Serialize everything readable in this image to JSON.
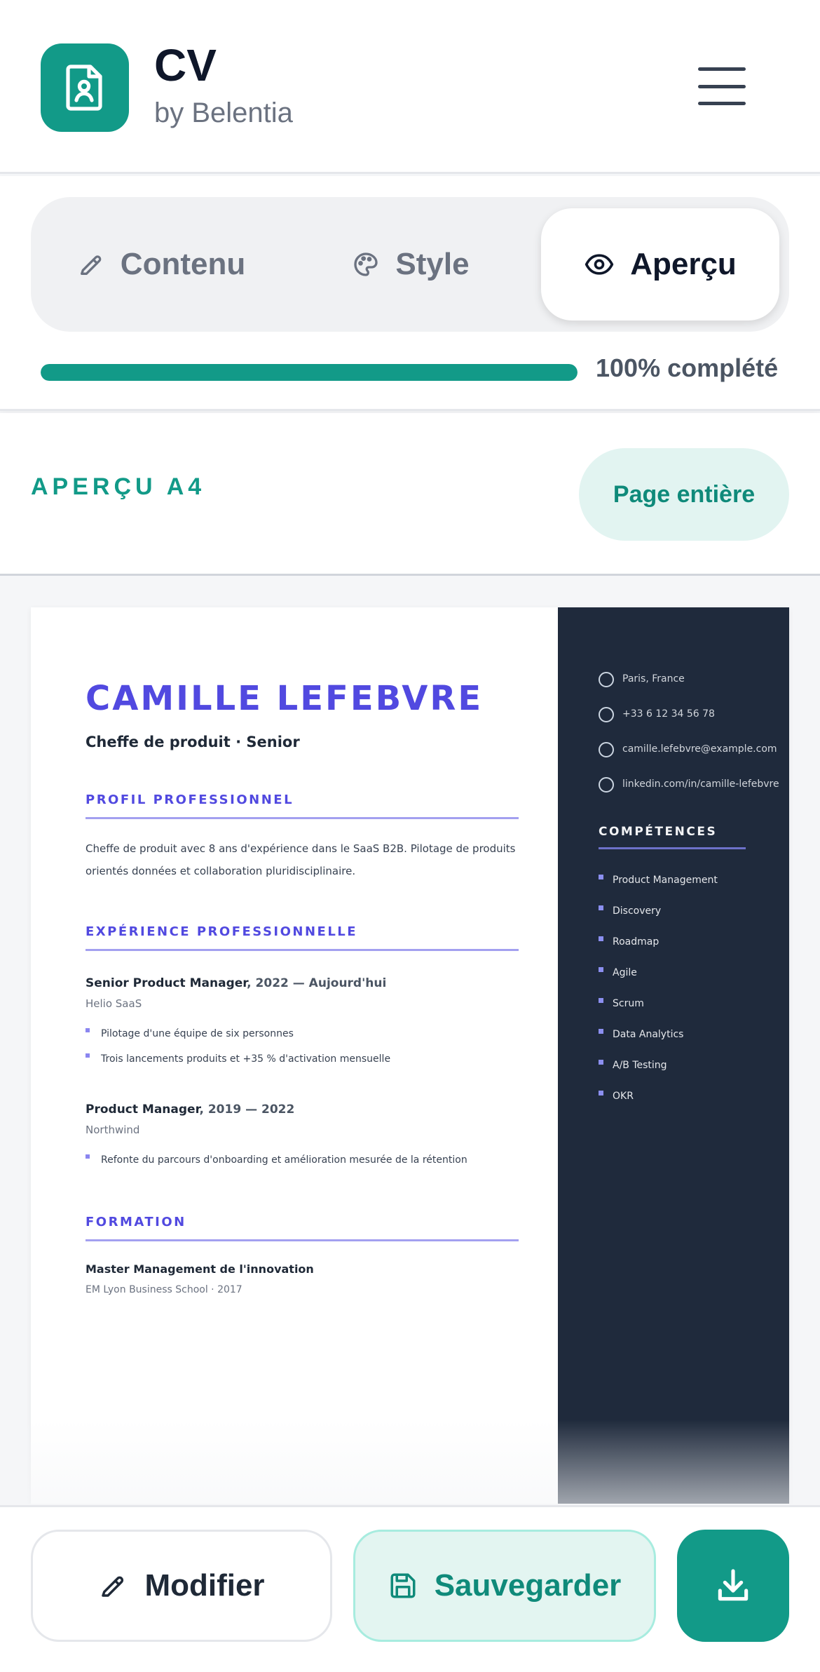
{
  "header": {
    "title": "CV",
    "subtitle": "by Belentia",
    "logo_icon": "resume-icon",
    "menu_icon": "hamburger-icon"
  },
  "tabs": [
    {
      "label": "Contenu",
      "icon": "pencil-icon",
      "active": false
    },
    {
      "label": "Style",
      "icon": "palette-icon",
      "active": false
    },
    {
      "label": "Aperçu",
      "icon": "eye-icon",
      "active": true
    }
  ],
  "progress": {
    "value": 100,
    "label": "100% complété"
  },
  "preview": {
    "label": "APERÇU A4",
    "full_page_button": "Page entière"
  },
  "cv": {
    "name": "CAMILLE LEFEBVRE",
    "role": "Cheffe de produit · Senior",
    "profile_title": "PROFIL PROFESSIONNEL",
    "profile_text": "Cheffe de produit avec 8 ans d'expérience dans le SaaS B2B. Pilotage de produits orientés données et collaboration pluridisciplinaire.",
    "experience_title": "EXPÉRIENCE PROFESSIONNELLE",
    "jobs": [
      {
        "title": "Senior Product Manager",
        "dates": ", 2022 — Aujourd'hui",
        "company": "Helio SaaS",
        "bullets": [
          "Pilotage d'une équipe de six personnes",
          "Trois lancements produits et +35 % d'activation mensuelle"
        ]
      },
      {
        "title": "Product Manager",
        "dates": ", 2019 — 2022",
        "company": "Northwind",
        "bullets": [
          "Refonte du parcours d'onboarding et amélioration mesurée de la rétention"
        ]
      }
    ],
    "education_title": "FORMATION",
    "education": {
      "degree": "Master Management de l'innovation",
      "school": "EM Lyon Business School · 2017"
    },
    "contacts": [
      "Paris, France",
      "+33 6 12 34 56 78",
      "camille.lefebvre@example.com",
      "linkedin.com/in/camille-lefebvre"
    ],
    "skills_title": "COMPÉTENCES",
    "skills": [
      "Product Management",
      "Discovery",
      "Roadmap",
      "Agile",
      "Scrum",
      "Data Analytics",
      "A/B Testing",
      "OKR"
    ]
  },
  "actions": {
    "edit_label": "Modifier",
    "save_label": "Sauvegarder",
    "download_icon": "download-icon"
  },
  "colors": {
    "accent": "#129a88",
    "cv_accent": "#5149e0",
    "cv_sidebar": "#1f2a3c"
  }
}
